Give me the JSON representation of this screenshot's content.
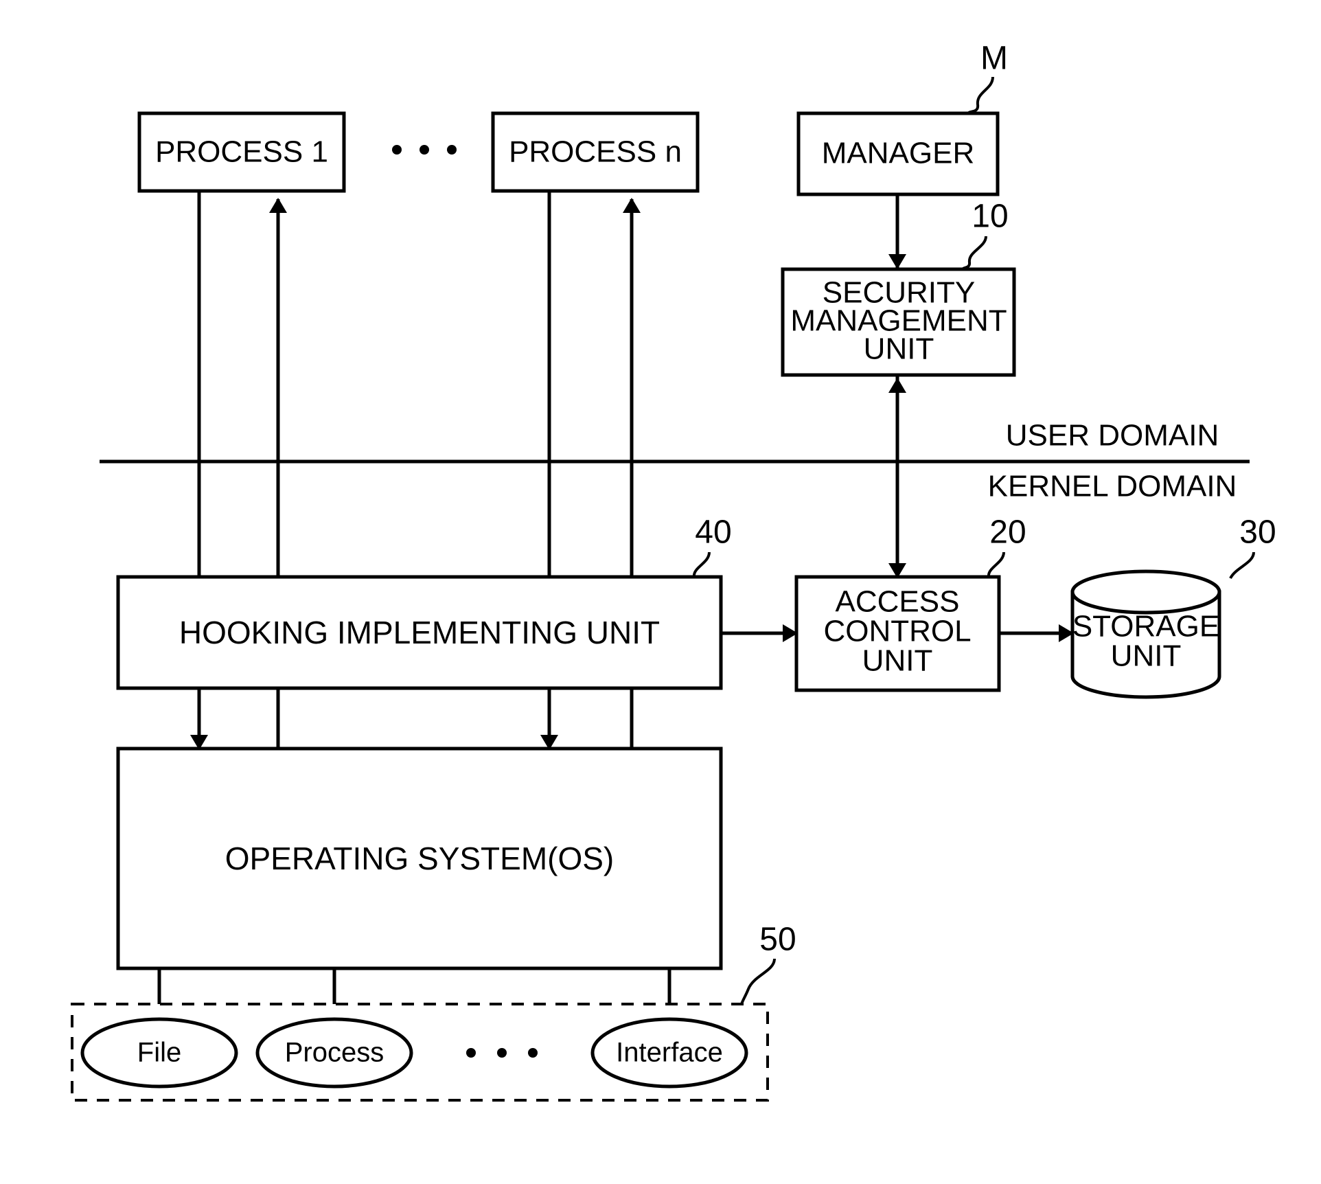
{
  "figure": {
    "title": "Security system block diagram",
    "background": "#ffffff",
    "line_color": "#000000"
  },
  "domains": {
    "user_label": "USER DOMAIN",
    "kernel_label": "KERNEL DOMAIN"
  },
  "blocks": {
    "process_1": "PROCESS 1",
    "process_n": "PROCESS n",
    "manager": "MANAGER",
    "security_management_unit_line1": "SECURITY",
    "security_management_unit_line2": "MANAGEMENT",
    "security_management_unit_line3": "UNIT",
    "hooking_unit": "HOOKING IMPLEMENTING UNIT",
    "access_control_unit_line1": "ACCESS",
    "access_control_unit_line2": "CONTROL",
    "access_control_unit_line3": "UNIT",
    "storage_unit_line1": "STORAGE",
    "storage_unit_line2": "UNIT",
    "operating_system": "OPERATING SYSTEM(OS)"
  },
  "resources": {
    "file": "File",
    "process": "Process",
    "interface": "Interface"
  },
  "reference_numerals": {
    "manager": "M",
    "security_management_unit": "10",
    "access_control_unit": "20",
    "storage_unit": "30",
    "hooking_unit": "40",
    "resource_group": "50"
  },
  "ellipsis": {
    "top": "• • •",
    "bottom": "• • •"
  }
}
